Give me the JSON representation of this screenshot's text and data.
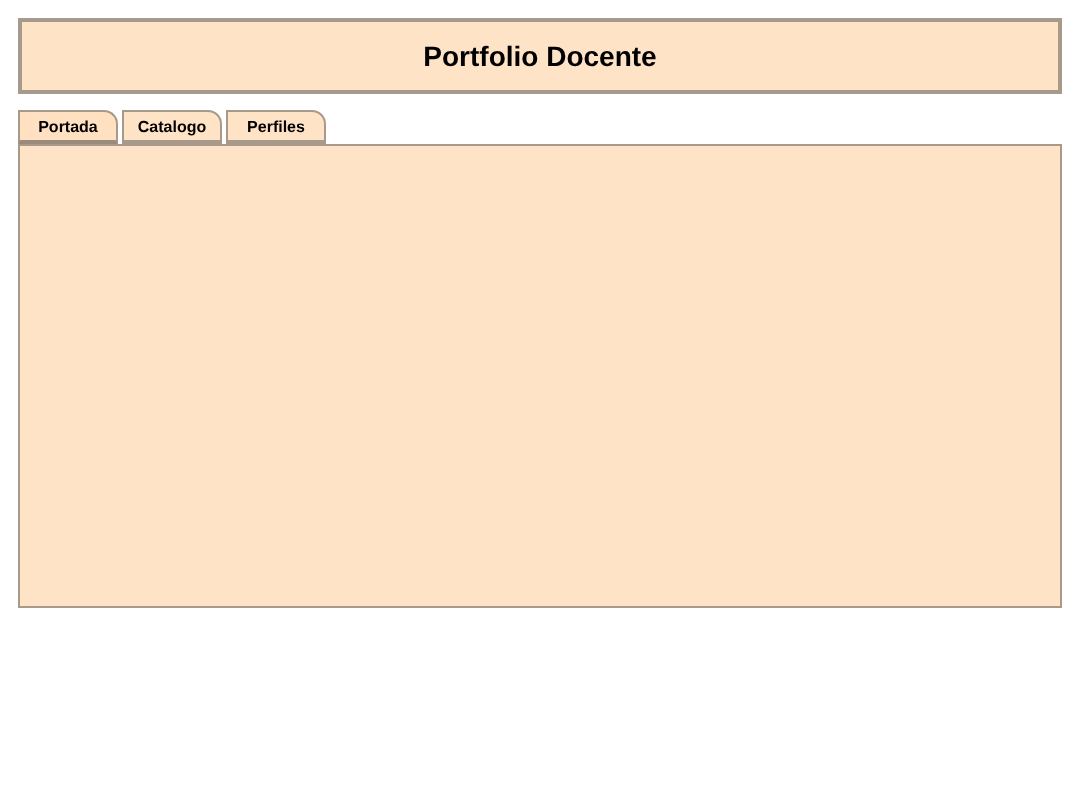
{
  "header": {
    "title": "Portfolio Docente"
  },
  "tabs": [
    {
      "label": "Portada",
      "selected": true
    },
    {
      "label": "Catalogo",
      "selected": false
    },
    {
      "label": "Perfiles",
      "selected": false
    }
  ]
}
